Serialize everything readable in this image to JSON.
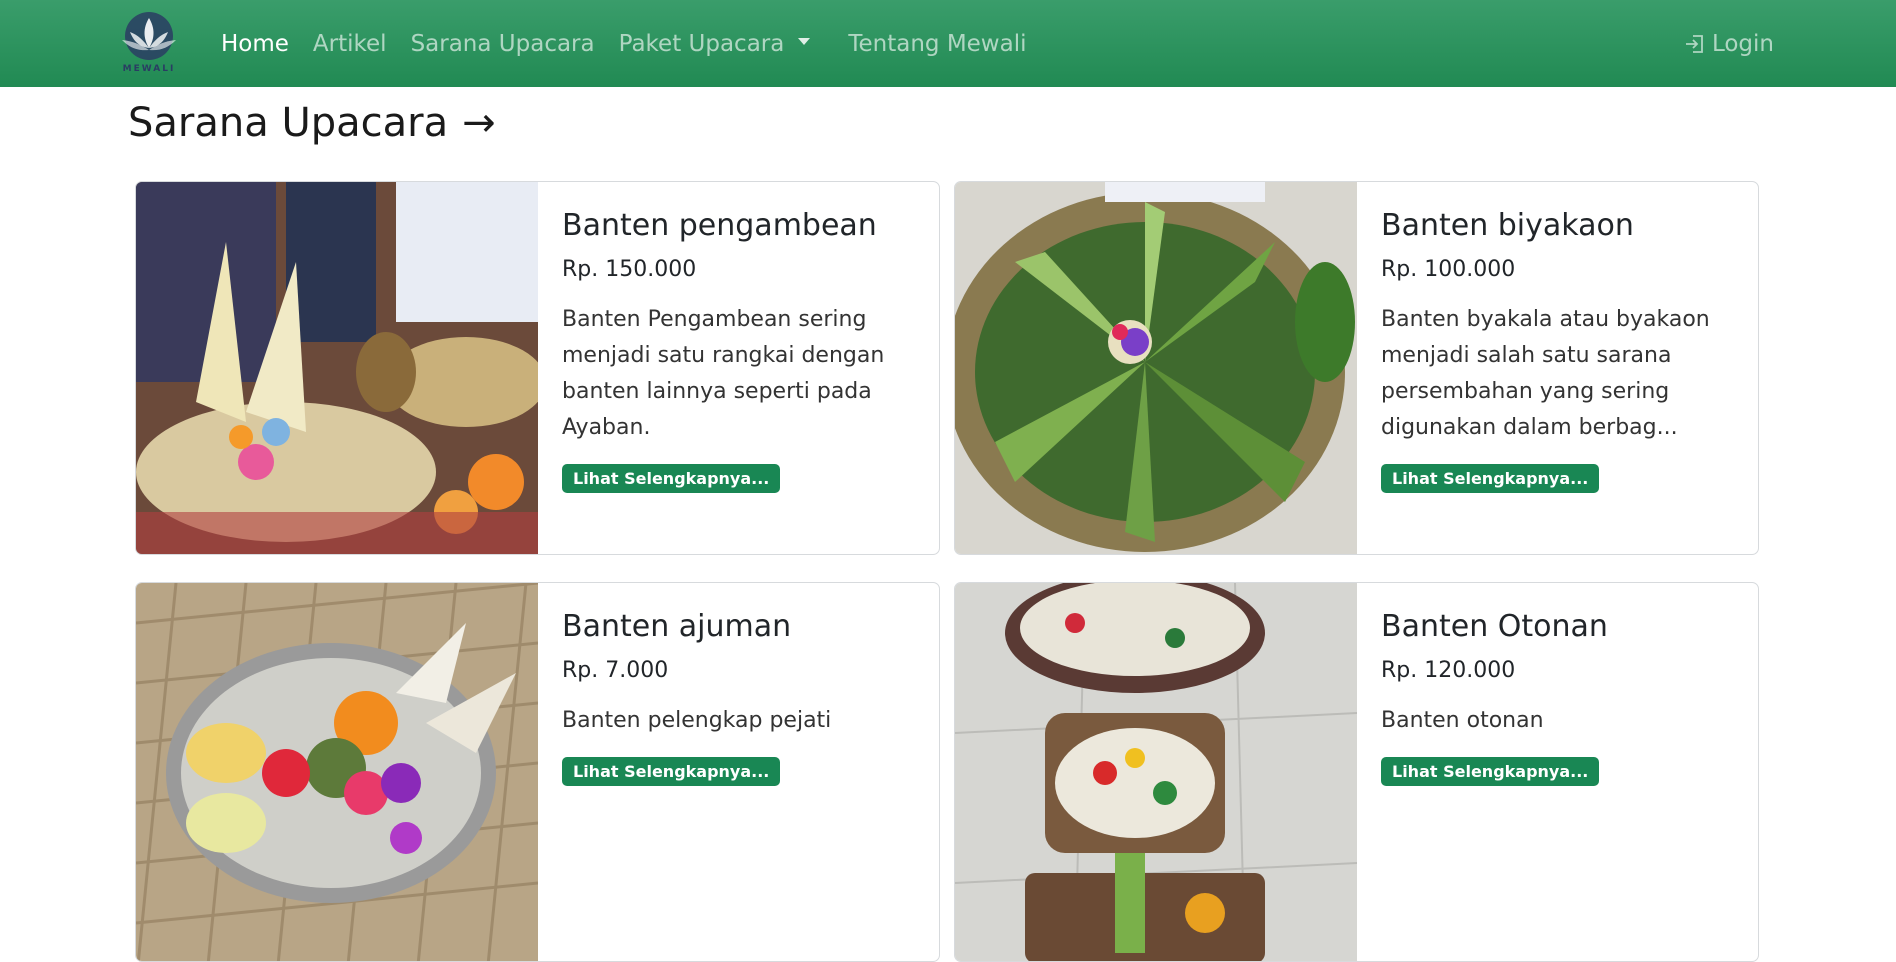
{
  "nav": {
    "brand_text": "MEWALI",
    "items": [
      {
        "label": "Home"
      },
      {
        "label": "Artikel"
      },
      {
        "label": "Sarana Upacara"
      },
      {
        "label": "Paket Upacara"
      },
      {
        "label": "Tentang Mewali"
      }
    ],
    "login_label": "Login"
  },
  "section": {
    "title": "Sarana Upacara",
    "arrow": "→"
  },
  "cards": [
    {
      "title": "Banten pengambean",
      "price": "Rp. 150.000",
      "description": "Banten Pengambean sering menjadi satu rangkai dengan banten lainnya seperti pada Ayaban.",
      "button_label": "Lihat Selengkapnya..."
    },
    {
      "title": "Banten biyakaon",
      "price": "Rp. 100.000",
      "description": "Banten byakala atau byakaon menjadi salah satu sarana persembahan yang sering digunakan dalam berbag...",
      "button_label": "Lihat Selengkapnya..."
    },
    {
      "title": "Banten ajuman",
      "price": "Rp. 7.000",
      "description": "Banten pelengkap pejati",
      "button_label": "Lihat Selengkapnya..."
    },
    {
      "title": "Banten Otonan",
      "price": "Rp. 120.000",
      "description": "Banten otonan",
      "button_label": "Lihat Selengkapnya..."
    }
  ],
  "colors": {
    "navbar": "#218a53",
    "button": "#198754",
    "text": "#212529"
  }
}
